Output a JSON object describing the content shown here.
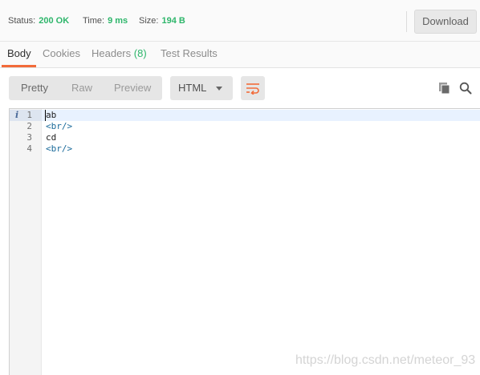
{
  "status": {
    "status_label": "Status:",
    "status_value": "200 OK",
    "time_label": "Time:",
    "time_value": "9 ms",
    "size_label": "Size:",
    "size_value": "194 B",
    "download_label": "Download"
  },
  "tabs": {
    "body": "Body",
    "cookies": "Cookies",
    "headers": "Headers",
    "headers_count": "(8)",
    "test_results": "Test Results"
  },
  "toolbar": {
    "pretty": "Pretty",
    "raw": "Raw",
    "preview": "Preview",
    "language": "HTML",
    "wrap_icon": "wrap-lines-icon",
    "copy_icon": "copy-icon",
    "search_icon": "search-icon"
  },
  "editor": {
    "info_marker": "i",
    "lines": [
      {
        "num": "1",
        "text": "ab"
      },
      {
        "num": "2",
        "text": "<br/>"
      },
      {
        "num": "3",
        "text": "cd"
      },
      {
        "num": "4",
        "text": "<br/>"
      }
    ]
  },
  "colors": {
    "accent": "#f26b3a",
    "success": "#2eb66b"
  },
  "watermark": "https://blog.csdn.net/meteor_93"
}
